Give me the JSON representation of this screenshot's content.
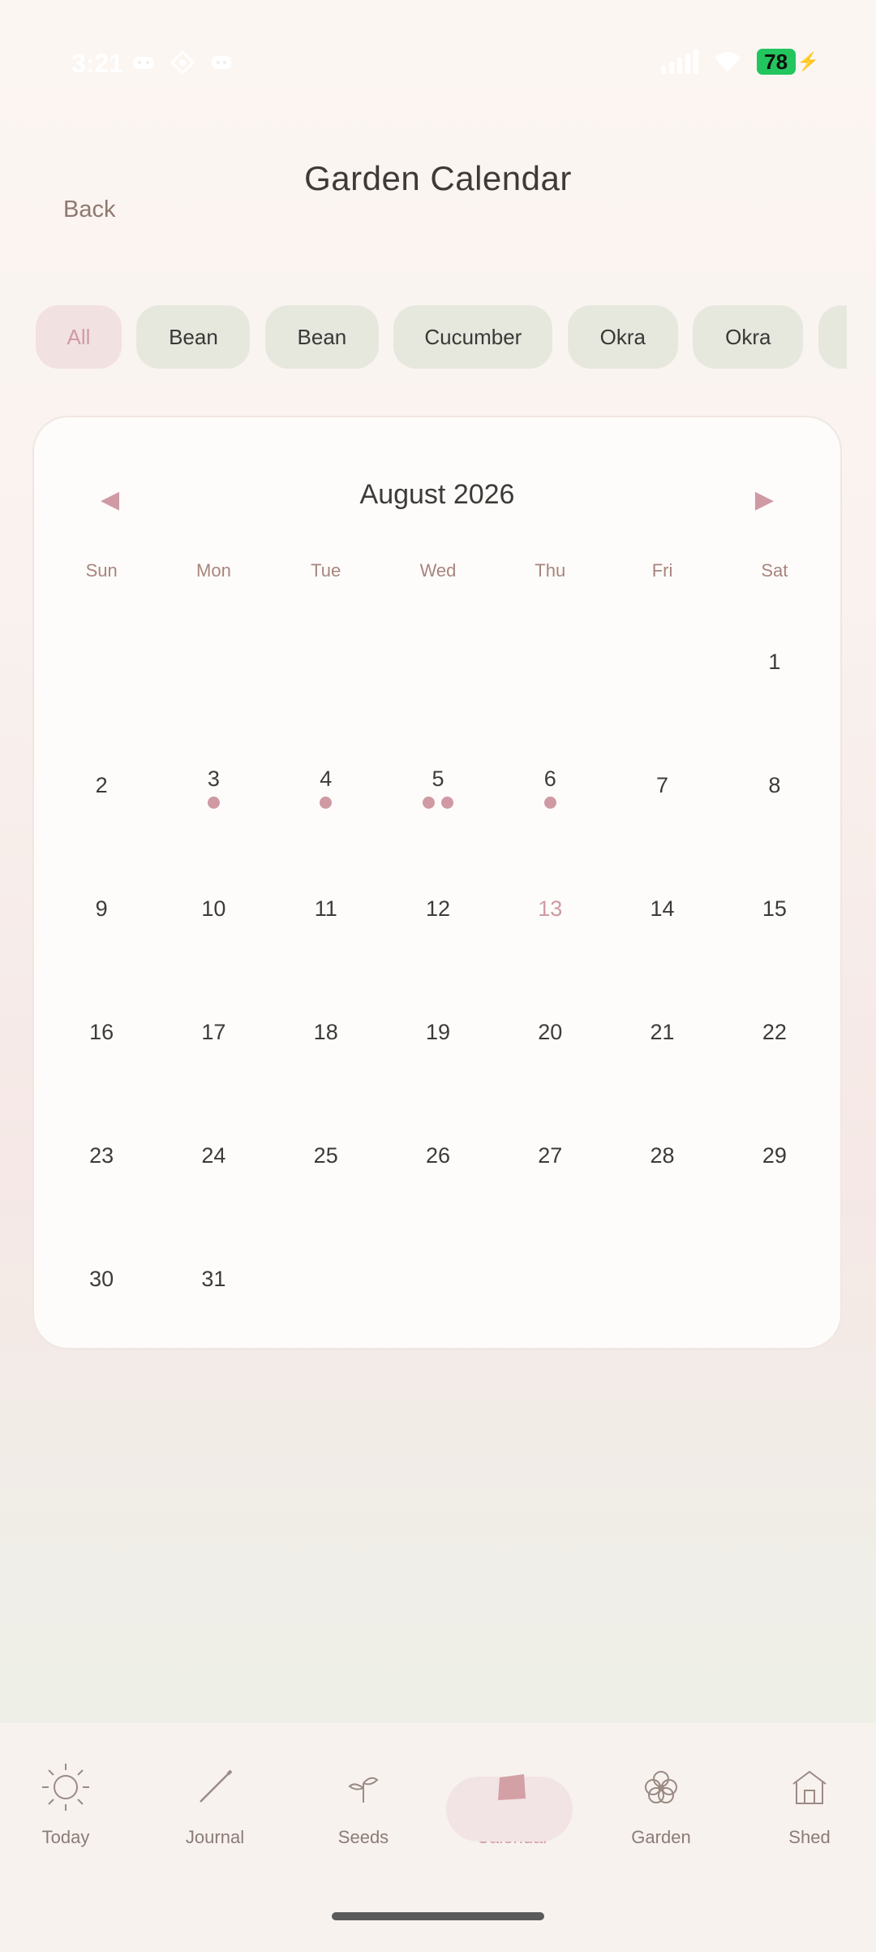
{
  "status_bar": {
    "time": "3:21",
    "battery": "78"
  },
  "header": {
    "title": "Garden Calendar",
    "back_label": "Back"
  },
  "filters": [
    {
      "label": "All",
      "active": true
    },
    {
      "label": "Bean",
      "active": false
    },
    {
      "label": "Bean",
      "active": false
    },
    {
      "label": "Cucumber",
      "active": false
    },
    {
      "label": "Okra",
      "active": false
    },
    {
      "label": "Okra",
      "active": false
    },
    {
      "label": "",
      "active": false
    }
  ],
  "calendar": {
    "month_label": "August 2026",
    "prev_icon": "◀",
    "next_icon": "▶",
    "weekdays": [
      "Sun",
      "Mon",
      "Tue",
      "Wed",
      "Thu",
      "Fri",
      "Sat"
    ],
    "first_weekday_index": 6,
    "days_in_month": 31,
    "today": 13,
    "event_dots": {
      "3": 1,
      "4": 1,
      "5": 2,
      "6": 1
    },
    "accent_color": "#cf9aa4"
  },
  "nav": {
    "items": [
      {
        "label": "Today",
        "icon": "sun-icon"
      },
      {
        "label": "Journal",
        "icon": "pencil-icon"
      },
      {
        "label": "Seeds",
        "icon": "sprout-icon"
      },
      {
        "label": "Calendar",
        "icon": "calendar-icon",
        "active": true
      },
      {
        "label": "Garden",
        "icon": "flower-icon"
      },
      {
        "label": "Shed",
        "icon": "shed-icon"
      }
    ]
  }
}
